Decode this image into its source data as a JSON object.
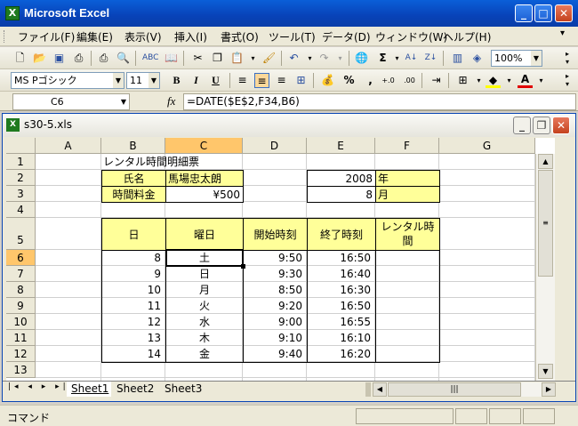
{
  "app": {
    "title": "Microsoft Excel"
  },
  "menus": [
    "ファイル(F)",
    "編集(E)",
    "表示(V)",
    "挿入(I)",
    "書式(O)",
    "ツール(T)",
    "データ(D)",
    "ウィンドウ(W)",
    "ヘルプ(H)"
  ],
  "toolbar": {
    "zoom": "100%",
    "font_name": "MS Pゴシック",
    "font_size": "11",
    "bold": "B",
    "italic": "I",
    "underline": "U",
    "percent": "%",
    "comma": ",",
    "sigma": "Σ"
  },
  "formula_bar": {
    "cell_ref": "C6",
    "fx": "fx",
    "formula": "=DATE($E$2,F34,B6)"
  },
  "workbook": {
    "title": "s30-5.xls"
  },
  "columns": [
    "A",
    "B",
    "C",
    "D",
    "E",
    "F",
    "G"
  ],
  "rows": [
    "1",
    "2",
    "3",
    "4",
    "5",
    "6",
    "7",
    "8",
    "9",
    "10",
    "11",
    "12",
    "13"
  ],
  "cells": {
    "B1": "レンタル時間明細票",
    "B2": "氏名",
    "C2": "馬場忠太朗",
    "E2": "2008",
    "F2": "年",
    "B3": "時間料金",
    "C3": "¥500",
    "E3": "8",
    "F3": "月",
    "B5": "日",
    "C5": "曜日",
    "D5": "開始時刻",
    "E5": "終了時刻",
    "F5a": "レンタル時",
    "F5b": "間"
  },
  "table": [
    {
      "day": "8",
      "weekday": "土",
      "start": "9:50",
      "end": "16:50"
    },
    {
      "day": "9",
      "weekday": "日",
      "start": "9:30",
      "end": "16:40"
    },
    {
      "day": "10",
      "weekday": "月",
      "start": "8:50",
      "end": "16:30"
    },
    {
      "day": "11",
      "weekday": "火",
      "start": "9:20",
      "end": "16:50"
    },
    {
      "day": "12",
      "weekday": "水",
      "start": "9:00",
      "end": "16:55"
    },
    {
      "day": "13",
      "weekday": "木",
      "start": "9:10",
      "end": "16:10"
    },
    {
      "day": "14",
      "weekday": "金",
      "start": "9:40",
      "end": "16:20"
    }
  ],
  "sheets": [
    "Sheet1",
    "Sheet2",
    "Sheet3"
  ],
  "status": "コマンド"
}
